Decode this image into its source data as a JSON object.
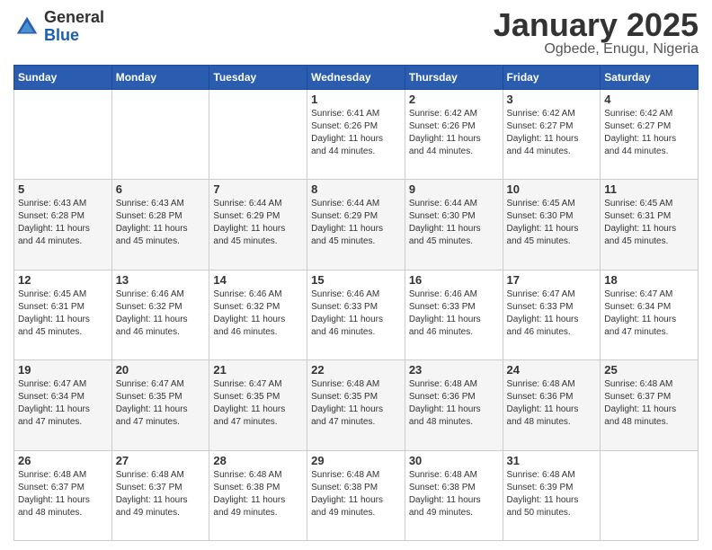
{
  "logo": {
    "general": "General",
    "blue": "Blue"
  },
  "title": {
    "month_year": "January 2025",
    "location": "Ogbede, Enugu, Nigeria"
  },
  "days_of_week": [
    "Sunday",
    "Monday",
    "Tuesday",
    "Wednesday",
    "Thursday",
    "Friday",
    "Saturday"
  ],
  "weeks": [
    [
      {
        "day": "",
        "info": ""
      },
      {
        "day": "",
        "info": ""
      },
      {
        "day": "",
        "info": ""
      },
      {
        "day": "1",
        "info": "Sunrise: 6:41 AM\nSunset: 6:26 PM\nDaylight: 11 hours\nand 44 minutes."
      },
      {
        "day": "2",
        "info": "Sunrise: 6:42 AM\nSunset: 6:26 PM\nDaylight: 11 hours\nand 44 minutes."
      },
      {
        "day": "3",
        "info": "Sunrise: 6:42 AM\nSunset: 6:27 PM\nDaylight: 11 hours\nand 44 minutes."
      },
      {
        "day": "4",
        "info": "Sunrise: 6:42 AM\nSunset: 6:27 PM\nDaylight: 11 hours\nand 44 minutes."
      }
    ],
    [
      {
        "day": "5",
        "info": "Sunrise: 6:43 AM\nSunset: 6:28 PM\nDaylight: 11 hours\nand 44 minutes."
      },
      {
        "day": "6",
        "info": "Sunrise: 6:43 AM\nSunset: 6:28 PM\nDaylight: 11 hours\nand 45 minutes."
      },
      {
        "day": "7",
        "info": "Sunrise: 6:44 AM\nSunset: 6:29 PM\nDaylight: 11 hours\nand 45 minutes."
      },
      {
        "day": "8",
        "info": "Sunrise: 6:44 AM\nSunset: 6:29 PM\nDaylight: 11 hours\nand 45 minutes."
      },
      {
        "day": "9",
        "info": "Sunrise: 6:44 AM\nSunset: 6:30 PM\nDaylight: 11 hours\nand 45 minutes."
      },
      {
        "day": "10",
        "info": "Sunrise: 6:45 AM\nSunset: 6:30 PM\nDaylight: 11 hours\nand 45 minutes."
      },
      {
        "day": "11",
        "info": "Sunrise: 6:45 AM\nSunset: 6:31 PM\nDaylight: 11 hours\nand 45 minutes."
      }
    ],
    [
      {
        "day": "12",
        "info": "Sunrise: 6:45 AM\nSunset: 6:31 PM\nDaylight: 11 hours\nand 45 minutes."
      },
      {
        "day": "13",
        "info": "Sunrise: 6:46 AM\nSunset: 6:32 PM\nDaylight: 11 hours\nand 46 minutes."
      },
      {
        "day": "14",
        "info": "Sunrise: 6:46 AM\nSunset: 6:32 PM\nDaylight: 11 hours\nand 46 minutes."
      },
      {
        "day": "15",
        "info": "Sunrise: 6:46 AM\nSunset: 6:33 PM\nDaylight: 11 hours\nand 46 minutes."
      },
      {
        "day": "16",
        "info": "Sunrise: 6:46 AM\nSunset: 6:33 PM\nDaylight: 11 hours\nand 46 minutes."
      },
      {
        "day": "17",
        "info": "Sunrise: 6:47 AM\nSunset: 6:33 PM\nDaylight: 11 hours\nand 46 minutes."
      },
      {
        "day": "18",
        "info": "Sunrise: 6:47 AM\nSunset: 6:34 PM\nDaylight: 11 hours\nand 47 minutes."
      }
    ],
    [
      {
        "day": "19",
        "info": "Sunrise: 6:47 AM\nSunset: 6:34 PM\nDaylight: 11 hours\nand 47 minutes."
      },
      {
        "day": "20",
        "info": "Sunrise: 6:47 AM\nSunset: 6:35 PM\nDaylight: 11 hours\nand 47 minutes."
      },
      {
        "day": "21",
        "info": "Sunrise: 6:47 AM\nSunset: 6:35 PM\nDaylight: 11 hours\nand 47 minutes."
      },
      {
        "day": "22",
        "info": "Sunrise: 6:48 AM\nSunset: 6:35 PM\nDaylight: 11 hours\nand 47 minutes."
      },
      {
        "day": "23",
        "info": "Sunrise: 6:48 AM\nSunset: 6:36 PM\nDaylight: 11 hours\nand 48 minutes."
      },
      {
        "day": "24",
        "info": "Sunrise: 6:48 AM\nSunset: 6:36 PM\nDaylight: 11 hours\nand 48 minutes."
      },
      {
        "day": "25",
        "info": "Sunrise: 6:48 AM\nSunset: 6:37 PM\nDaylight: 11 hours\nand 48 minutes."
      }
    ],
    [
      {
        "day": "26",
        "info": "Sunrise: 6:48 AM\nSunset: 6:37 PM\nDaylight: 11 hours\nand 48 minutes."
      },
      {
        "day": "27",
        "info": "Sunrise: 6:48 AM\nSunset: 6:37 PM\nDaylight: 11 hours\nand 49 minutes."
      },
      {
        "day": "28",
        "info": "Sunrise: 6:48 AM\nSunset: 6:38 PM\nDaylight: 11 hours\nand 49 minutes."
      },
      {
        "day": "29",
        "info": "Sunrise: 6:48 AM\nSunset: 6:38 PM\nDaylight: 11 hours\nand 49 minutes."
      },
      {
        "day": "30",
        "info": "Sunrise: 6:48 AM\nSunset: 6:38 PM\nDaylight: 11 hours\nand 49 minutes."
      },
      {
        "day": "31",
        "info": "Sunrise: 6:48 AM\nSunset: 6:39 PM\nDaylight: 11 hours\nand 50 minutes."
      },
      {
        "day": "",
        "info": ""
      }
    ]
  ]
}
